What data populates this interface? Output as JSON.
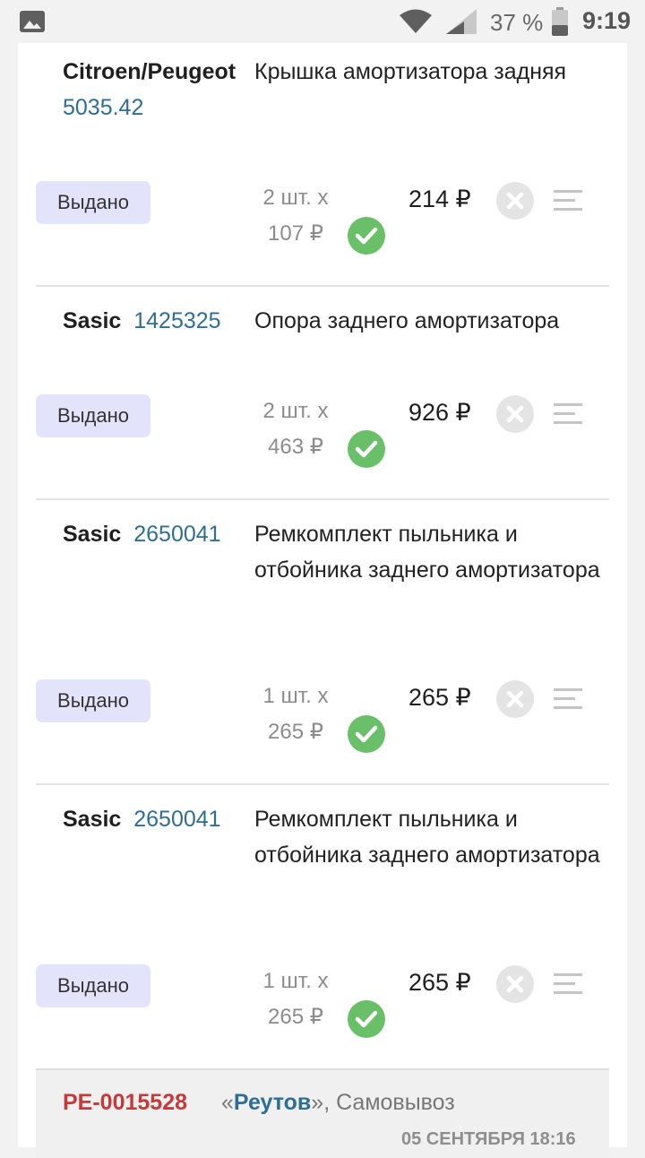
{
  "status_bar": {
    "battery": "37 %",
    "time": "9:19"
  },
  "items": [
    {
      "brand": "Citroen/Peugeot",
      "code": "5035.42",
      "description": "Крышка амортизатора задняя",
      "status": "Выдано",
      "qty": "2 шт. x",
      "unit_price": "107 ₽",
      "total": "214 ₽"
    },
    {
      "brand": "Sasic",
      "code": "1425325",
      "description": "Опора заднего амортизатора",
      "status": "Выдано",
      "qty": "2 шт. x",
      "unit_price": "463 ₽",
      "total": "926 ₽"
    },
    {
      "brand": "Sasic",
      "code": "2650041",
      "description": "Ремкомплект пыльника и отбойника заднего амортизатора",
      "status": "Выдано",
      "qty": "1 шт. x",
      "unit_price": "265 ₽",
      "total": "265 ₽"
    },
    {
      "brand": "Sasic",
      "code": "2650041",
      "description": "Ремкомплект пыльника и отбойника заднего амортизатора",
      "status": "Выдано",
      "qty": "1 шт. x",
      "unit_price": "265 ₽",
      "total": "265 ₽"
    }
  ],
  "order": {
    "id": "РЕ-0015528",
    "quote_open": "«",
    "city": "Реутов",
    "quote_close": "»",
    "delivery": ", Самовывоз",
    "date": "05 СЕНТЯБРЯ 18:16"
  },
  "colors": {
    "accent_blue": "#2e6d95",
    "order_red": "#c43a3a",
    "status_pill": "#e3e4fb",
    "check_green": "#6abf69"
  }
}
